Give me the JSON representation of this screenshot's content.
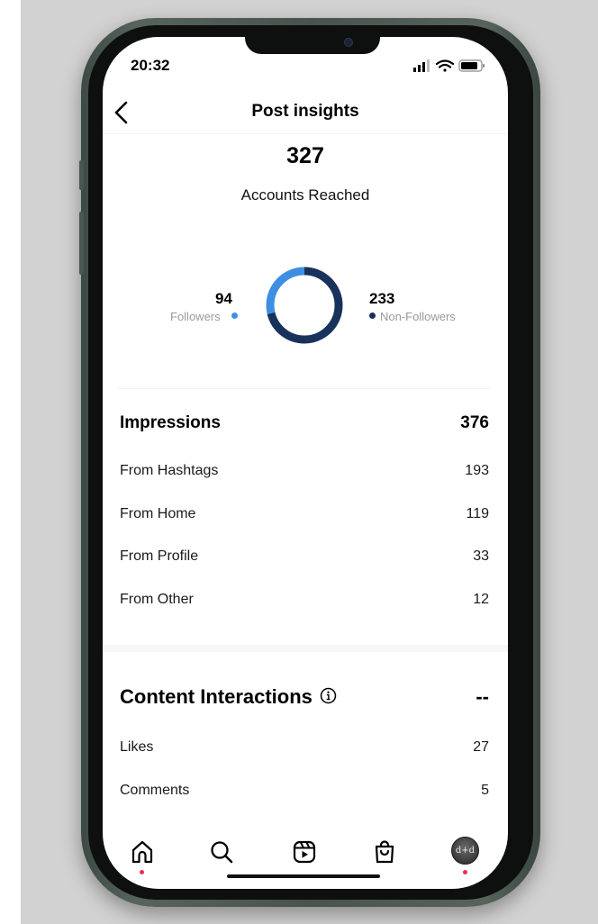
{
  "status_bar": {
    "time": "20:32"
  },
  "header": {
    "title": "Post insights"
  },
  "reach": {
    "value": "327",
    "label": "Accounts Reached",
    "followers": {
      "value": "94",
      "label": "Followers",
      "color": "#3e8fe3"
    },
    "non_followers": {
      "value": "233",
      "label": "Non-Followers",
      "color": "#19325c"
    }
  },
  "impressions": {
    "title": "Impressions",
    "total": "376",
    "rows": [
      {
        "label": "From Hashtags",
        "value": "193"
      },
      {
        "label": "From Home",
        "value": "119"
      },
      {
        "label": "From Profile",
        "value": "33"
      },
      {
        "label": "From Other",
        "value": "12"
      }
    ]
  },
  "interactions": {
    "title": "Content Interactions",
    "total": "--",
    "rows": [
      {
        "label": "Likes",
        "value": "27"
      },
      {
        "label": "Comments",
        "value": "5"
      }
    ]
  },
  "tab_bar": {
    "tabs": [
      "home-icon",
      "search-icon",
      "reels-icon",
      "shop-icon",
      "profile-avatar"
    ],
    "avatar_text": "d+d"
  }
}
